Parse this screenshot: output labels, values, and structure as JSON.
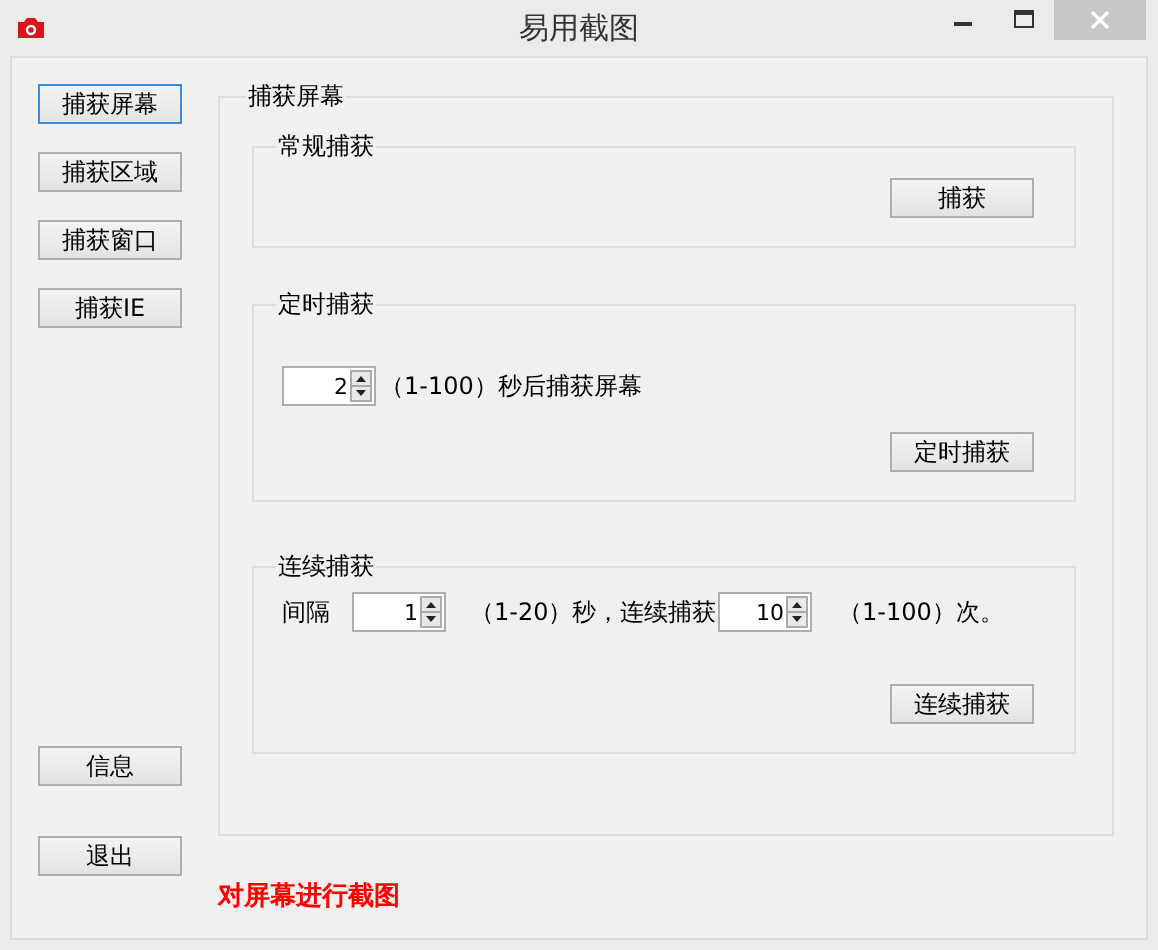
{
  "window": {
    "title": "易用截图"
  },
  "side_buttons": [
    {
      "label": "捕获屏幕",
      "selected": true
    },
    {
      "label": "捕获区域",
      "selected": false
    },
    {
      "label": "捕获窗口",
      "selected": false
    },
    {
      "label": "捕获IE",
      "selected": false
    }
  ],
  "bottom_buttons": [
    "信息",
    "退出"
  ],
  "capture_panel": {
    "title": "捕获屏幕",
    "groups": [
      {
        "kind": "plain",
        "title": "常规捕获",
        "button": "捕获"
      },
      {
        "kind": "timed",
        "title": "定时捕获",
        "delay": "2",
        "delay_hint": "（1-100）秒后捕获屏幕",
        "button": "定时捕获"
      },
      {
        "kind": "continuous",
        "title": "连续捕获",
        "interval_label": "间隔",
        "interval": "1",
        "interval_hint": "（1-20）秒，连续捕获",
        "count": "10",
        "count_hint": "（1-100）次。",
        "button": "连续捕获"
      }
    ]
  },
  "status": "对屏幕进行截图"
}
